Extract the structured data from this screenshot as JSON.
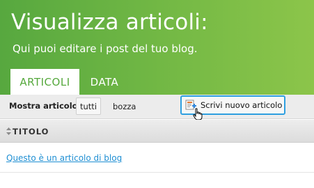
{
  "header": {
    "title": "Visualizza articoli:",
    "subtitle": "Qui puoi editare i post del tuo blog."
  },
  "tabs": [
    {
      "label": "ARTICOLI",
      "active": true
    },
    {
      "label": "DATA",
      "active": false
    }
  ],
  "filter": {
    "label": "Mostra articolo:",
    "options": [
      {
        "label": "tutti",
        "selected": true
      },
      {
        "label": "bozza",
        "selected": false
      }
    ]
  },
  "new_article_button": {
    "label": "Scrivi nuovo articolo",
    "icon": "new-document-icon"
  },
  "table": {
    "column_header": "TITOLO",
    "rows": [
      {
        "title": "Questo è un articolo di blog"
      }
    ]
  },
  "colors": {
    "header_green": "#6db543",
    "tab_active_text": "#55a83c",
    "link_blue": "#1f8fd3",
    "button_border": "#2e9fe0"
  }
}
